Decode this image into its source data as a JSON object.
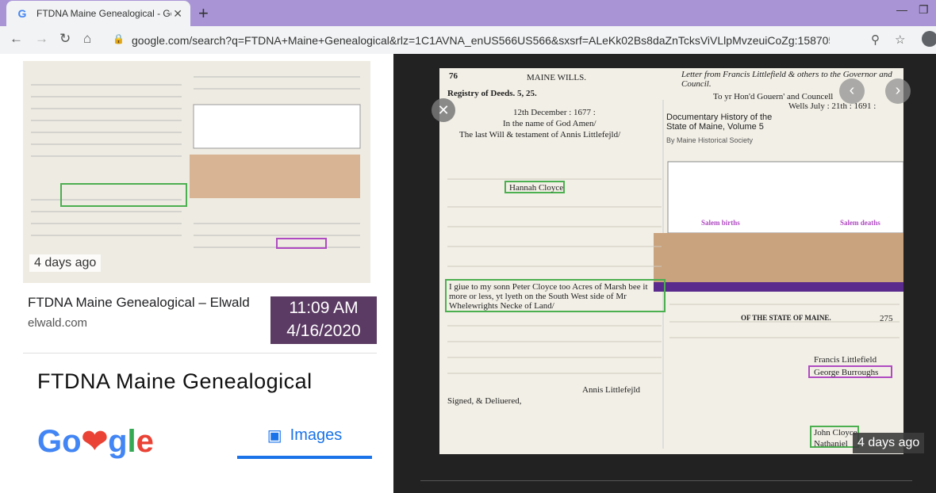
{
  "browser": {
    "tab_title": "FTDNA Maine Genealogical - Go",
    "url": "google.com/search?q=FTDNA+Maine+Genealogical&rlz=1C1AVNA_enUS566US566&sxsrf=ALeKk02Bs8daZnTcksViVLlpMvzeuiCoZg:1587056616747&so..."
  },
  "left": {
    "thumb_time": "4 days ago",
    "result_title": "FTDNA Maine Genealogical – Elwald",
    "result_site": "elwald.com",
    "overlay_time": "11:09 AM",
    "overlay_date": "4/16/2020",
    "big_title": "FTDNA Maine Genealogical",
    "google_logo": "Go❤gle",
    "images_label": "Images"
  },
  "viewer": {
    "time": "4 days ago",
    "doc": {
      "page_num": "76",
      "header": "MAINE WILLS.",
      "letter": "Letter from Francis Littlefield & others to the Governor and Council.",
      "registry": "Registry of Deeds. 5, 25.",
      "date": "12th December : 1677 :",
      "inname": "In the name of God Amen/",
      "will": "The last Will & testament of Annis Littlefejld/",
      "hon": "To yr Hon'd Gouern' and Councell",
      "wells": "Wells July : 21th : 1691 :",
      "dhs": "Documentary History of the State of Maine, Volume 5",
      "society": "By Maine Historical Society",
      "births": "Salem births",
      "deaths": "Salem deaths",
      "hannah": "Hannah Cloyce",
      "peter": "I giue to my sonn Peter Cloyce too Acres of Marsh bee it more or less, yt lyeth on the South West side of Mr Whelewrights Necke of Land/",
      "state": "OF THE STATE OF MAINE.",
      "page275": "275",
      "burroughs": "George Burroughs",
      "francis": "Francis Littlefield",
      "cloyce": "John Cloyce",
      "nathaniel": "Nathaniel",
      "annis": "Annis Littlefejld",
      "signed": "Signed, & Deliuered,"
    }
  }
}
